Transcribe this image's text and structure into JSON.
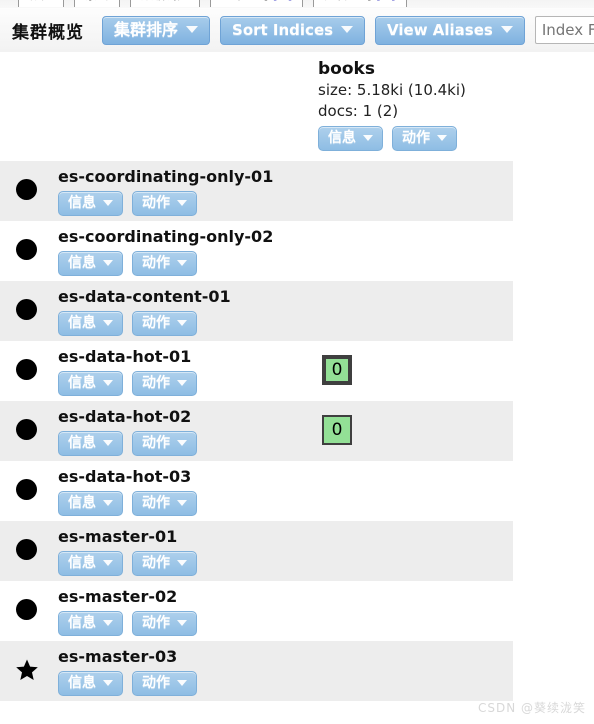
{
  "tabstrip": {
    "tabs": [
      {
        "label": "概览",
        "bracket": ""
      },
      {
        "label": "索引",
        "bracket": ""
      },
      {
        "label": "数据浏览",
        "bracket": ""
      },
      {
        "label": "基本查询",
        "bracket": "[+]"
      },
      {
        "label": "复合查询",
        "bracket": "[+]"
      }
    ]
  },
  "toolbar": {
    "cluster_title": "集群概览",
    "sort_nodes_label": "集群排序",
    "sort_indices_label": "Sort Indices",
    "view_aliases_label": "View Aliases",
    "index_filter_value": "",
    "index_filter_placeholder": "Index Filter",
    "caret_icon": "chevron-down-icon"
  },
  "index_column": {
    "name": "books",
    "size_line": "size: 5.18ki (10.4ki)",
    "docs_line": "docs: 1 (2)",
    "info_label": "信息",
    "action_label": "动作"
  },
  "nodes": [
    {
      "name": "es-coordinating-only-01",
      "marker": "circle",
      "info_label": "信息",
      "action_label": "动作",
      "shard": null
    },
    {
      "name": "es-coordinating-only-02",
      "marker": "circle",
      "info_label": "信息",
      "action_label": "动作",
      "shard": null
    },
    {
      "name": "es-data-content-01",
      "marker": "circle",
      "info_label": "信息",
      "action_label": "动作",
      "shard": null
    },
    {
      "name": "es-data-hot-01",
      "marker": "circle",
      "info_label": "信息",
      "action_label": "动作",
      "shard": {
        "label": "0",
        "type": "primary"
      }
    },
    {
      "name": "es-data-hot-02",
      "marker": "circle",
      "info_label": "信息",
      "action_label": "动作",
      "shard": {
        "label": "0",
        "type": "replica"
      }
    },
    {
      "name": "es-data-hot-03",
      "marker": "circle",
      "info_label": "信息",
      "action_label": "动作",
      "shard": null
    },
    {
      "name": "es-master-01",
      "marker": "circle",
      "info_label": "信息",
      "action_label": "动作",
      "shard": null
    },
    {
      "name": "es-master-02",
      "marker": "circle",
      "info_label": "信息",
      "action_label": "动作",
      "shard": null
    },
    {
      "name": "es-master-03",
      "marker": "star",
      "info_label": "信息",
      "action_label": "动作",
      "shard": null
    }
  ],
  "colors": {
    "button_blue": "#7fb2e0",
    "shard_green": "#93e096",
    "shard_border": "#3f3f3f",
    "row_alt": "#ededed"
  },
  "watermark": "CSDN @葵续泷笑"
}
